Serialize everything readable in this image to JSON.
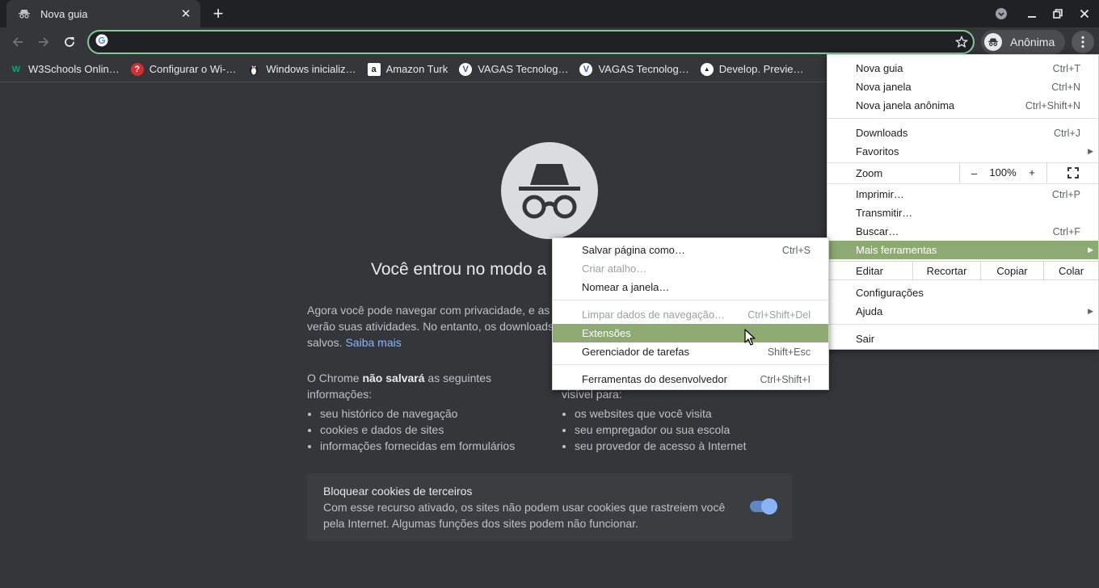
{
  "tab": {
    "title": "Nova guia",
    "close_icon": "close-icon",
    "favicon": "incognito-icon"
  },
  "window": {
    "new_tab": "+",
    "minimize": "minimize-icon",
    "restore": "restore-icon",
    "close": "close-icon"
  },
  "toolbar": {
    "omnibox_value": "",
    "profile_label": "Anônima"
  },
  "bookmarks": [
    {
      "label": "W3Schools Onlin…",
      "icon": "W",
      "color": "#04aa6d"
    },
    {
      "label": "Configurar o Wi-…",
      "icon": "?",
      "color": "#e53935"
    },
    {
      "label": "Windows inicializ…",
      "icon": "🐧",
      "color": "#35363a"
    },
    {
      "label": "Amazon Turk",
      "icon": "a",
      "color": "#ffffff"
    },
    {
      "label": "VAGAS Tecnolog…",
      "icon": "V",
      "color": "#ffffff"
    },
    {
      "label": "VAGAS Tecnolog…",
      "icon": "V",
      "color": "#ffffff"
    },
    {
      "label": "Develop. Previe…",
      "icon": "▲",
      "color": "#ffffff"
    }
  ],
  "page": {
    "heading": "Você entrou no modo a",
    "intro_line1": "Agora você pode navegar com privacidade, e as o",
    "intro_line2": "verão suas atividades. No entanto, os downloads",
    "intro_line3": "salvos.",
    "learn_more": "Saiba mais",
    "left_title_a": "O Chrome ",
    "left_title_b": "não salvará",
    "left_title_c": " as seguintes",
    "left_title_d": "informações:",
    "left_items": [
      "seu histórico de navegação",
      "cookies e dados de sites",
      "informações fornecidas em formulários"
    ],
    "right_title": "visível para:",
    "right_items": [
      "os websites que você visita",
      "seu empregador ou sua escola",
      "seu provedor de acesso à Internet"
    ],
    "cookie_title": "Bloquear cookies de terceiros",
    "cookie_desc": "Com esse recurso ativado, os sites não podem usar cookies que rastreiem você pela Internet. Algumas funções dos sites podem não funcionar."
  },
  "menu": {
    "new_tab": "Nova guia",
    "new_tab_sc": "Ctrl+T",
    "new_window": "Nova janela",
    "new_window_sc": "Ctrl+N",
    "new_incognito": "Nova janela anônima",
    "new_incognito_sc": "Ctrl+Shift+N",
    "downloads": "Downloads",
    "downloads_sc": "Ctrl+J",
    "favorites": "Favoritos",
    "zoom": "Zoom",
    "zoom_minus": "–",
    "zoom_value": "100%",
    "zoom_plus": "+",
    "print": "Imprimir…",
    "print_sc": "Ctrl+P",
    "cast": "Transmitir…",
    "find": "Buscar…",
    "find_sc": "Ctrl+F",
    "more_tools": "Mais ferramentas",
    "edit": "Editar",
    "cut": "Recortar",
    "copy": "Copiar",
    "paste": "Colar",
    "settings": "Configurações",
    "help": "Ajuda",
    "exit": "Sair"
  },
  "submenu": {
    "save_page": "Salvar página como…",
    "save_page_sc": "Ctrl+S",
    "create_shortcut": "Criar atalho…",
    "name_window": "Nomear a janela…",
    "clear_data": "Limpar dados de navegação…",
    "clear_data_sc": "Ctrl+Shift+Del",
    "extensions": "Extensões",
    "task_manager": "Gerenciador de tarefas",
    "task_manager_sc": "Shift+Esc",
    "dev_tools": "Ferramentas do desenvolvedor",
    "dev_tools_sc": "Ctrl+Shift+I"
  },
  "colors": {
    "highlight": "#8daa72",
    "omnibox_border": "#81c995",
    "link": "#8ab4f8"
  }
}
